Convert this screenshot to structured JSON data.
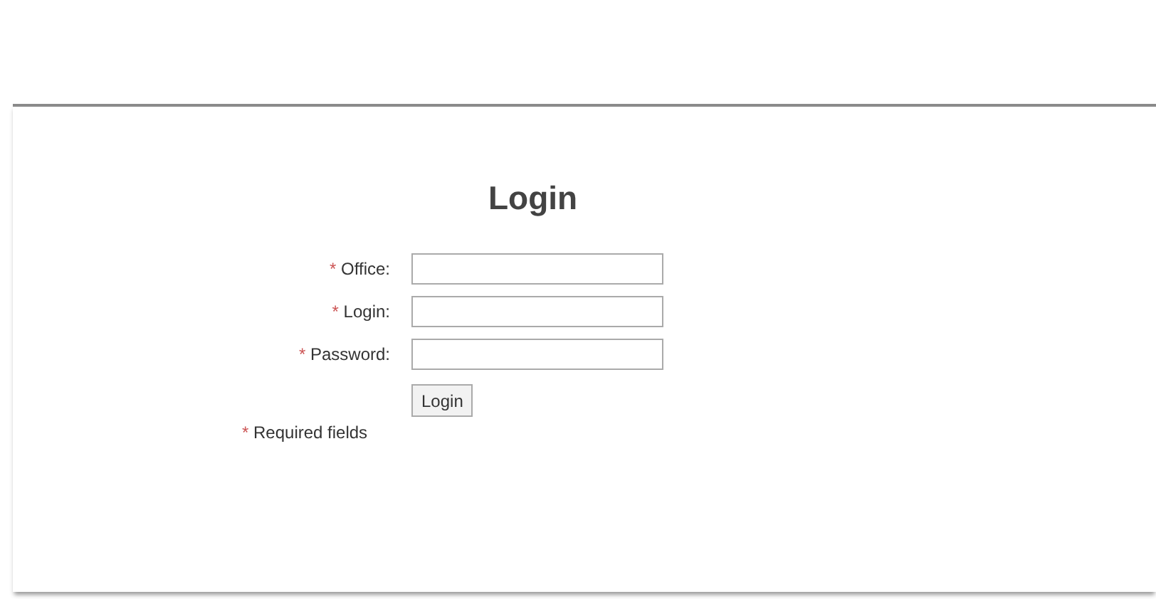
{
  "title": "Login",
  "required_mark": "*",
  "fields": [
    {
      "label": "Office:",
      "required": true
    },
    {
      "label": "Login:",
      "required": true
    },
    {
      "label": "Password:",
      "required": true
    }
  ],
  "button": "Login",
  "note": {
    "mark": "*",
    "text": "Required fields"
  }
}
